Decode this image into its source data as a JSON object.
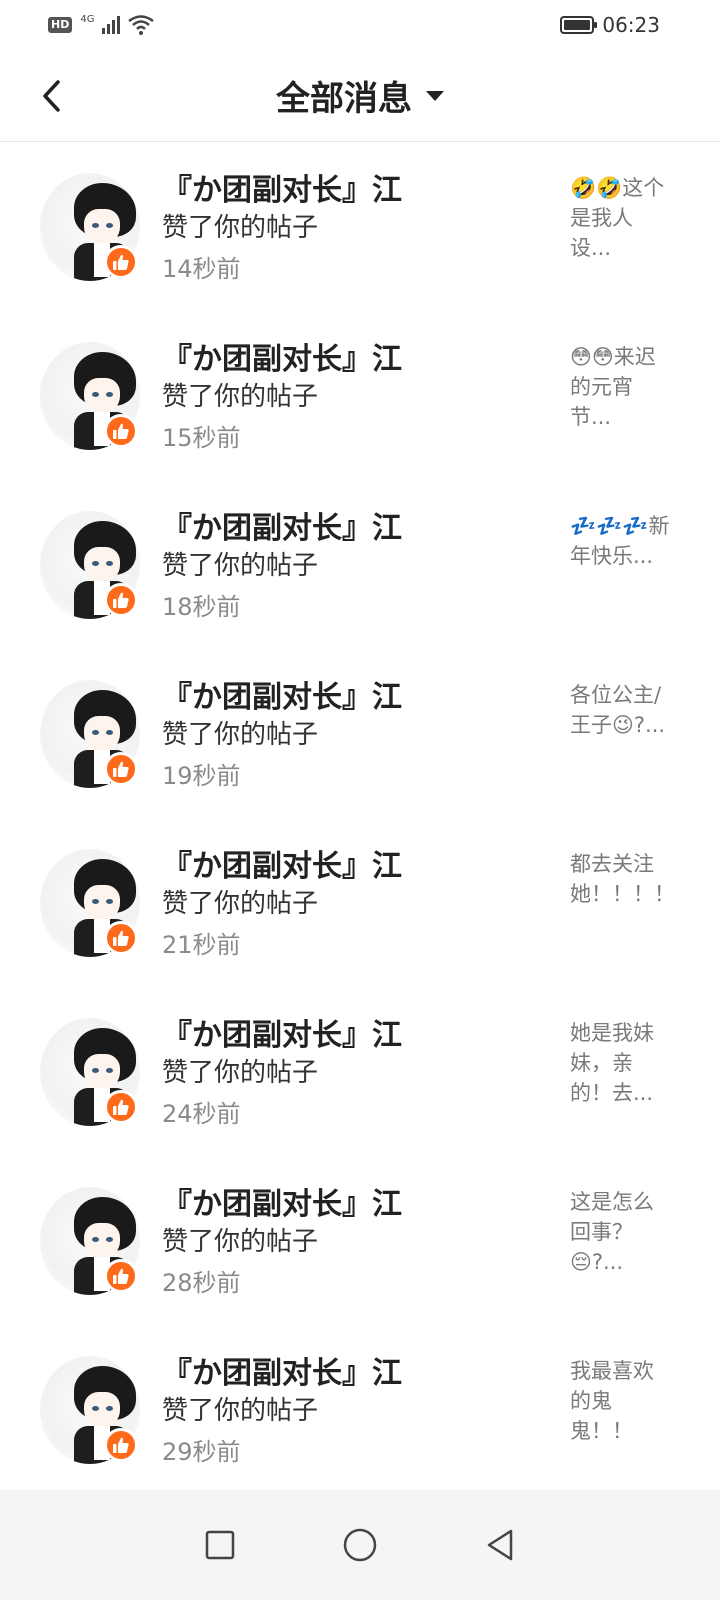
{
  "status_bar": {
    "hd_label": "HD",
    "network_label": "4G",
    "time": "06:23"
  },
  "header": {
    "title": "全部消息"
  },
  "icons": {
    "back": "chevron-left-icon",
    "dropdown": "caret-down-icon",
    "like": "thumbs-up-icon",
    "nav_recent": "square-icon",
    "nav_home": "circle-icon",
    "nav_back": "triangle-back-icon"
  },
  "colors": {
    "like_badge": "#ff6a1a",
    "time_text": "#8a8a8a",
    "preview_text": "#7a7a7a"
  },
  "messages": [
    {
      "name": "『か团副对长』江",
      "action": "赞了你的帖子",
      "time": "14秒前",
      "preview": "🤣🤣这个是我人设..."
    },
    {
      "name": "『か团副对长』江",
      "action": "赞了你的帖子",
      "time": "15秒前",
      "preview": "😳😳来迟的元宵节..."
    },
    {
      "name": "『か团副对长』江",
      "action": "赞了你的帖子",
      "time": "18秒前",
      "preview": "💤💤💤新年快乐..."
    },
    {
      "name": "『か团副对长』江",
      "action": "赞了你的帖子",
      "time": "19秒前",
      "preview": "各位公主/王子😉?..."
    },
    {
      "name": "『か团副对长』江",
      "action": "赞了你的帖子",
      "time": "21秒前",
      "preview": "都去关注她！！！！！"
    },
    {
      "name": "『か团副对长』江",
      "action": "赞了你的帖子",
      "time": "24秒前",
      "preview": "她是我妹妹，亲的！去..."
    },
    {
      "name": "『か团副对长』江",
      "action": "赞了你的帖子",
      "time": "28秒前",
      "preview": "这是怎么回事？😔?..."
    },
    {
      "name": "『か团副对长』江",
      "action": "赞了你的帖子",
      "time": "29秒前",
      "preview": "我最喜欢的鬼鬼！！丶..."
    }
  ]
}
